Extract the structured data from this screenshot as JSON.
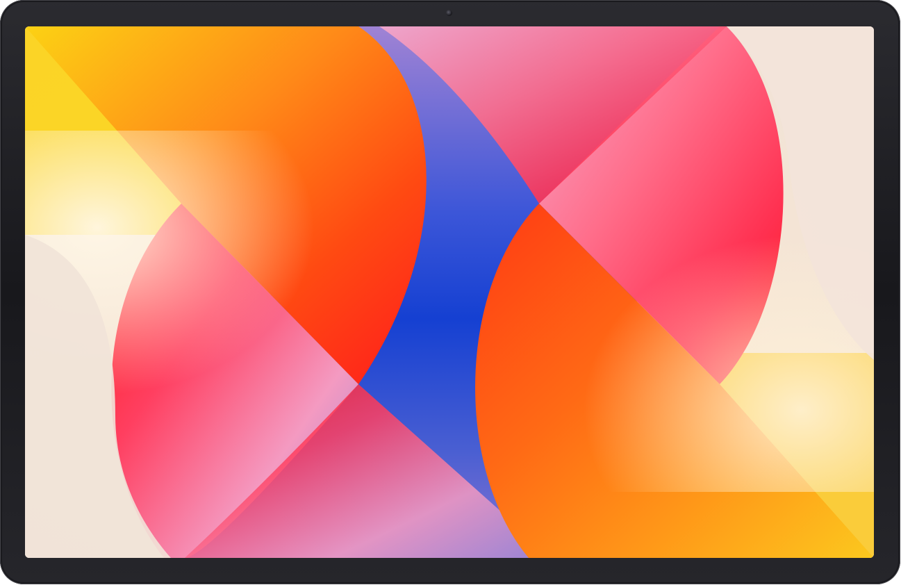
{
  "device": {
    "frame_color": "#1f1f23",
    "camera_icon": "front-camera-icon"
  },
  "wallpaper": {
    "left_swirl": {
      "name": "left-swirl",
      "stops": [
        "#fcd313",
        "#ff8d1a",
        "#ff4a12",
        "#ff1a1a",
        "#ff3d5c",
        "#f58fb4",
        "#9b86d6"
      ]
    },
    "center_band": {
      "stops": [
        "#9b7fd4",
        "#3d52d9",
        "#1640d4",
        "#2f4fd0",
        "#8a72d1"
      ]
    },
    "right_swirl": {
      "name": "right-swirl",
      "stops": [
        "#f5a0c6",
        "#ff6f8c",
        "#ff3050",
        "#ff1a1a",
        "#ff4b12",
        "#ff8d1a",
        "#fcc81e"
      ]
    },
    "background": "#f3e9de"
  }
}
